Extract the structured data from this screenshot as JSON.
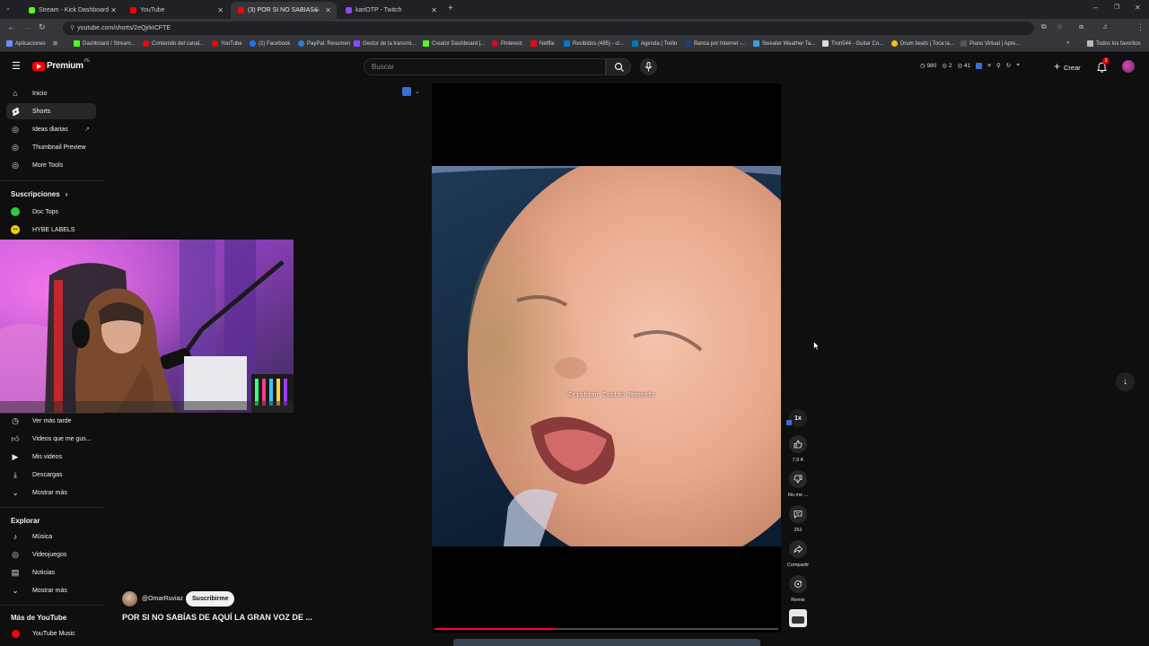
{
  "browser": {
    "tabs": [
      {
        "label": "Stream - Kick Dashboard",
        "color": "#53fc18"
      },
      {
        "label": "YouTube",
        "color": "#ff0000"
      },
      {
        "label": "(3) POR SI NO SABÍAS DE A",
        "color": "#ff0000"
      },
      {
        "label": "kariOTP - Twitch",
        "color": "#9146ff"
      }
    ],
    "url": "youtube.com/shorts/2eQjrkICFTE",
    "bookmarks": [
      "Aplicaciones",
      "Dashboard / Stream...",
      "Contenido del canal...",
      "YouTube",
      "(2) Facebook",
      "PayPal: Resumen",
      "Gestor de la transmi...",
      "Creator Dashboard |...",
      "Pinterest",
      "Netflix",
      "Recibidos (495) - cl...",
      "Agenda | Trello",
      "Banca por Internet -...",
      "Sweater Weather Ta...",
      "Tron544 - Guitar Co...",
      "Drum beats | Toca la...",
      "Piano Virtual | Apre..."
    ],
    "all_bookmarks": "Todos los favoritos"
  },
  "masthead": {
    "logo": "Premium",
    "region": "PE",
    "search_placeholder": "Buscar",
    "stats": {
      "views": "980",
      "likes": "2",
      "viewers": "41"
    },
    "create_label": "Crear",
    "notif_count": "3"
  },
  "sidebar": {
    "main": [
      {
        "label": "Inicio",
        "icon": "home-icon"
      },
      {
        "label": "Shorts",
        "icon": "shorts-icon"
      },
      {
        "label": "Ideas diarias",
        "icon": "ideas-icon"
      },
      {
        "label": "Thumbnail Preview",
        "icon": "extension-icon"
      },
      {
        "label": "More Tools",
        "icon": "extension-icon"
      }
    ],
    "subs_title": "Suscripciones",
    "subs": [
      {
        "label": "Doc Tops",
        "color": "#2ecc40"
      },
      {
        "label": "HYBE LABELS",
        "color": "#f5d100"
      }
    ],
    "you": [
      {
        "label": "Ver más tarde",
        "icon": "clock-icon"
      },
      {
        "label": "Videos que me gus...",
        "icon": "like-icon"
      },
      {
        "label": "Mis videos",
        "icon": "play-icon"
      },
      {
        "label": "Descargas",
        "icon": "download-icon"
      },
      {
        "label": "Mostrar más",
        "icon": "chevron-down-icon"
      }
    ],
    "explore_title": "Explorar",
    "explore": [
      {
        "label": "Música",
        "icon": "music-icon"
      },
      {
        "label": "Videojuegos",
        "icon": "gamepad-icon"
      },
      {
        "label": "Noticias",
        "icon": "news-icon"
      },
      {
        "label": "Mostrar más",
        "icon": "chevron-down-icon"
      }
    ],
    "more_title": "Más de YouTube",
    "more": [
      {
        "label": "YouTube Music",
        "icon": "yt-music-icon"
      }
    ]
  },
  "short": {
    "overlay_text": "Cristian Castro Moments",
    "channel": "@OmarRuviaz",
    "subscribe": "Suscribirme",
    "title": "POR SI NO SABÍAS DE AQUÍ LA GRAN VOZ DE ...",
    "speed": "1x",
    "likes": "7,9 K",
    "dislike": "No me ...",
    "comments": "261",
    "share": "Compartir",
    "remix": "Remix",
    "progress": 0.35
  }
}
